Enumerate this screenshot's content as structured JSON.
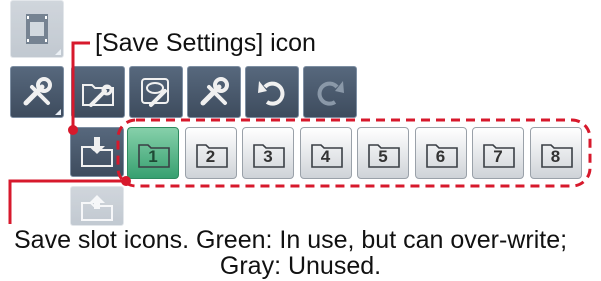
{
  "callouts": {
    "save_settings_icon": "[Save Settings] icon",
    "save_slot_line1": "Save slot icons. Green: In use, but can over-write;",
    "save_slot_line2": "Gray: Unused."
  },
  "slots": [
    {
      "label": "1",
      "state": "in-use"
    },
    {
      "label": "2",
      "state": "unused"
    },
    {
      "label": "3",
      "state": "unused"
    },
    {
      "label": "4",
      "state": "unused"
    },
    {
      "label": "5",
      "state": "unused"
    },
    {
      "label": "6",
      "state": "unused"
    },
    {
      "label": "7",
      "state": "unused"
    },
    {
      "label": "8",
      "state": "unused"
    }
  ],
  "toolbar": {
    "icons": [
      "film-strip-icon",
      "tools-icon",
      "folder-tools-icon",
      "disk-tools-icon",
      "tools-icon",
      "undo-icon",
      "redo-icon",
      "save-settings-icon",
      "load-settings-icon"
    ]
  },
  "colors": {
    "in_use_slot": "#4cb383",
    "unused_slot": "#e2e5e8",
    "callout_line": "#d7192c",
    "toolbar_tile": "#4b5a6c"
  }
}
